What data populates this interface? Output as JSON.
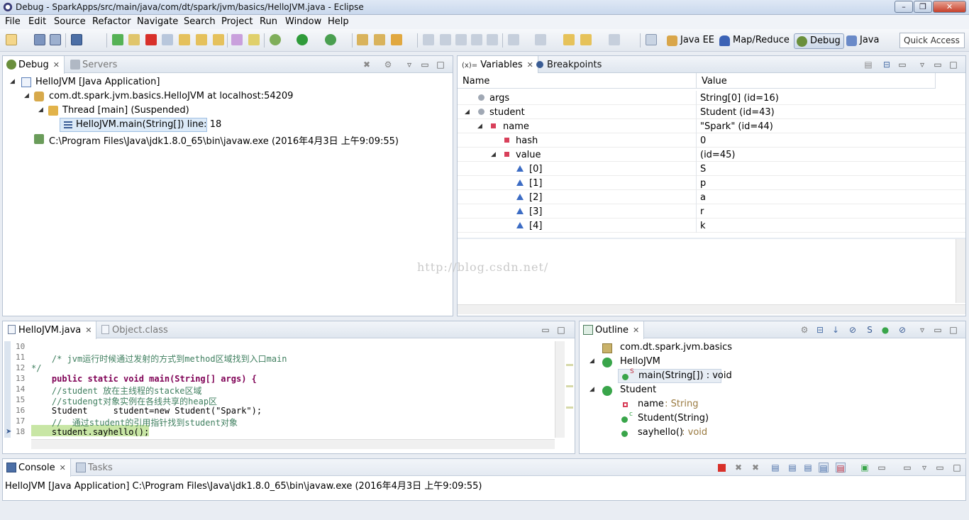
{
  "window": {
    "title": "Debug - SparkApps/src/main/java/com/dt/spark/jvm/basics/HelloJVM.java - Eclipse"
  },
  "menu": [
    "File",
    "Edit",
    "Source",
    "Refactor",
    "Navigate",
    "Search",
    "Project",
    "Run",
    "Window",
    "Help"
  ],
  "perspectives": [
    {
      "label": "Java EE",
      "icon": "java-ee-icon"
    },
    {
      "label": "Map/Reduce",
      "icon": "elephant-icon"
    },
    {
      "label": "Debug",
      "icon": "bug-icon",
      "active": true
    },
    {
      "label": "Java",
      "icon": "java-perspective-icon"
    }
  ],
  "quick_access": "Quick Access",
  "debug_view": {
    "tabs": [
      {
        "label": "Debug",
        "active": true
      },
      {
        "label": "Servers",
        "active": false
      }
    ],
    "tree": [
      {
        "label": "HelloJVM [Java Application]",
        "level": 0,
        "icon": "java-app-icon"
      },
      {
        "label": "com.dt.spark.jvm.basics.HelloJVM at localhost:54209",
        "level": 1,
        "icon": "vm-icon"
      },
      {
        "label": "Thread [main] (Suspended)",
        "level": 2,
        "icon": "thread-icon"
      },
      {
        "label": "HelloJVM.main(String[]) line: 18",
        "level": 3,
        "icon": "stack-frame-icon",
        "selected": true
      },
      {
        "label": "C:\\Program Files\\Java\\jdk1.8.0_65\\bin\\javaw.exe (2016年4月3日 上午9:09:55)",
        "level": 1,
        "icon": "process-icon"
      }
    ]
  },
  "variables_view": {
    "tabs": [
      {
        "label": "Variables",
        "prefix": "(x)=",
        "active": true
      },
      {
        "label": "Breakpoints",
        "active": false
      }
    ],
    "columns": [
      "Name",
      "Value"
    ],
    "rows": [
      {
        "name": "args",
        "value": "String[0]  (id=16)",
        "indent": 0,
        "icon": "local-var-icon"
      },
      {
        "name": "student",
        "value": "Student  (id=43)",
        "indent": 0,
        "icon": "local-var-icon",
        "expanded": true
      },
      {
        "name": "name",
        "value": "\"Spark\" (id=44)",
        "indent": 1,
        "icon": "private-field-icon",
        "expanded": true
      },
      {
        "name": "hash",
        "value": "0",
        "indent": 2,
        "icon": "private-field-icon"
      },
      {
        "name": "value",
        "value": "(id=45)",
        "indent": 2,
        "icon": "final-field-icon",
        "expanded": true
      },
      {
        "name": "[0]",
        "value": "S",
        "indent": 3,
        "icon": "array-element-icon"
      },
      {
        "name": "[1]",
        "value": "p",
        "indent": 3,
        "icon": "array-element-icon"
      },
      {
        "name": "[2]",
        "value": "a",
        "indent": 3,
        "icon": "array-element-icon"
      },
      {
        "name": "[3]",
        "value": "r",
        "indent": 3,
        "icon": "array-element-icon"
      },
      {
        "name": "[4]",
        "value": "k",
        "indent": 3,
        "icon": "array-element-icon"
      }
    ]
  },
  "watermark": "http://blog.csdn.net/",
  "editor": {
    "tabs": [
      {
        "label": "HelloJVM.java",
        "active": true
      },
      {
        "label": "Object.class",
        "active": false
      }
    ],
    "lines": [
      {
        "num": "10",
        "text": ""
      },
      {
        "num": "11",
        "text": "    /* jvm运行时候通过发射的方式到method区域找到入口main"
      },
      {
        "num": "12",
        "text": "*/"
      },
      {
        "num": "13",
        "text": "    public static void main(String[] args) {"
      },
      {
        "num": "14",
        "text": "    //student 放在主线程的stacke区域"
      },
      {
        "num": "15",
        "text": "    //studengt对象实例在各线共享的heap区"
      },
      {
        "num": "16",
        "text": "    Student     student=new Student(\"Spark\");"
      },
      {
        "num": "17",
        "text": "    //  通过student的引用指针找到student对象"
      },
      {
        "num": "18",
        "text": "    student.sayhello();"
      }
    ]
  },
  "outline_view": {
    "tab": "Outline",
    "items": [
      {
        "label": "com.dt.spark.jvm.basics",
        "type": "",
        "level": 0,
        "icon": "package-icon"
      },
      {
        "label": "HelloJVM",
        "type": "",
        "level": 0,
        "icon": "class-icon",
        "expanded": true
      },
      {
        "label": "main(String[]) : void",
        "type": "",
        "level": 1,
        "icon": "public-static-method-icon",
        "selected": true
      },
      {
        "label": "Student",
        "type": "",
        "level": 0,
        "icon": "class-icon",
        "expanded": true
      },
      {
        "label": "name",
        "type": " : String",
        "level": 1,
        "icon": "private-field-icon"
      },
      {
        "label": "Student(String)",
        "type": "",
        "level": 1,
        "icon": "constructor-icon"
      },
      {
        "label": "sayhello()",
        "type": " : void",
        "level": 1,
        "icon": "public-method-icon"
      }
    ]
  },
  "console_view": {
    "tabs": [
      {
        "label": "Console",
        "active": true
      },
      {
        "label": "Tasks",
        "active": false
      }
    ],
    "header": "HelloJVM [Java Application] C:\\Program Files\\Java\\jdk1.8.0_65\\bin\\javaw.exe (2016年4月3日 上午9:09:55)"
  },
  "colors": {
    "debug_highlight": "#c8e6a5",
    "selection": "#dceaf8",
    "keyword": "#7f0055",
    "comment": "#3f7f5f",
    "string": "#2a00ff"
  }
}
